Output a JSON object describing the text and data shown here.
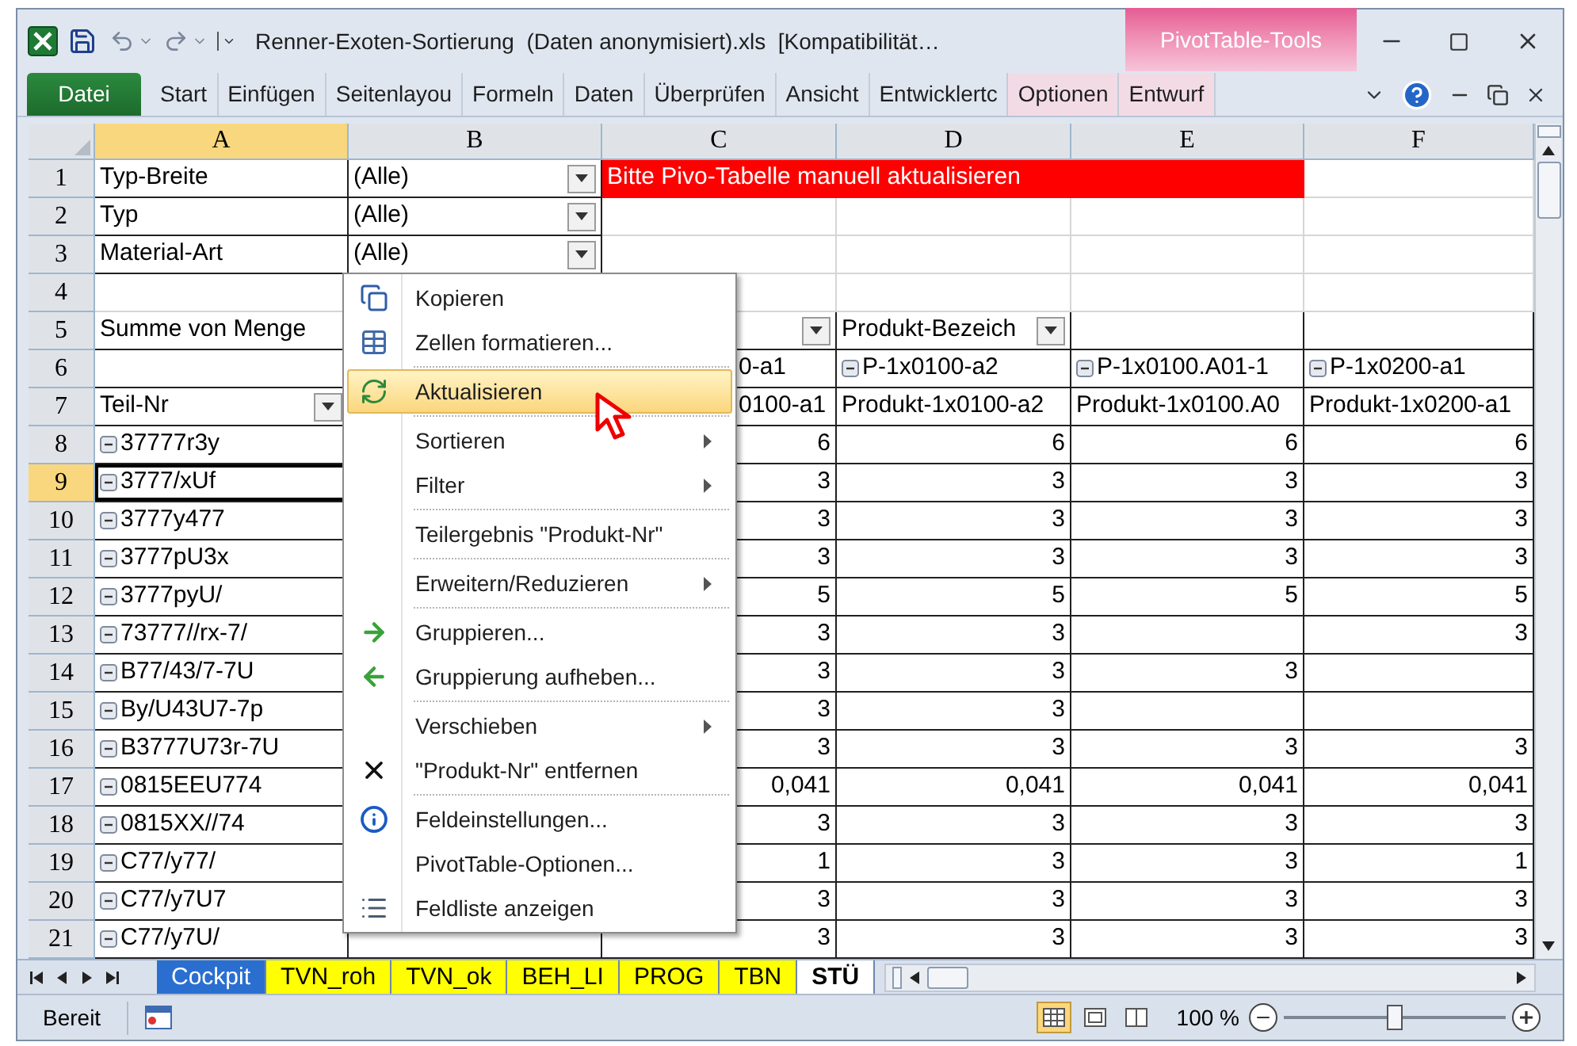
{
  "window": {
    "title": "Renner-Exoten-Sortierung  (Daten anonymisiert).xls  [Kompatibilität…",
    "context_group": "PivotTable-Tools"
  },
  "ribbon_tabs": [
    {
      "label": "Datei",
      "kind": "file"
    },
    {
      "label": "Start",
      "kind": "normal"
    },
    {
      "label": "Einfügen",
      "kind": "normal"
    },
    {
      "label": "Seitenlayou",
      "kind": "normal"
    },
    {
      "label": "Formeln",
      "kind": "normal"
    },
    {
      "label": "Daten",
      "kind": "normal"
    },
    {
      "label": "Überprüfen",
      "kind": "normal"
    },
    {
      "label": "Ansicht",
      "kind": "normal"
    },
    {
      "label": "Entwicklertc",
      "kind": "normal"
    },
    {
      "label": "Optionen",
      "kind": "context"
    },
    {
      "label": "Entwurf",
      "kind": "context"
    }
  ],
  "sheet": {
    "columns": [
      {
        "label": "A",
        "selected": true
      },
      {
        "label": "B",
        "selected": false
      },
      {
        "label": "C",
        "selected": false
      },
      {
        "label": "D",
        "selected": false
      },
      {
        "label": "E",
        "selected": false
      },
      {
        "label": "F",
        "selected": false
      }
    ],
    "rows": [
      {
        "number": "1",
        "selected": false,
        "cells": [
          {
            "kind": "text",
            "text": "Typ-Breite"
          },
          {
            "kind": "dropdown",
            "text": "(Alle)"
          },
          {
            "kind": "banner",
            "text": "Bitte Pivo-Tabelle manuell aktualisieren"
          },
          {
            "kind": "empty"
          }
        ]
      },
      {
        "number": "2",
        "selected": false,
        "cells": [
          {
            "kind": "text",
            "text": "Typ"
          },
          {
            "kind": "dropdown",
            "text": "(Alle)"
          },
          {
            "kind": "empty"
          },
          {
            "kind": "empty"
          },
          {
            "kind": "empty"
          },
          {
            "kind": "empty"
          }
        ]
      },
      {
        "number": "3",
        "selected": false,
        "cells": [
          {
            "kind": "text",
            "text": "Material-Art"
          },
          {
            "kind": "dropdown",
            "text": "(Alle)"
          },
          {
            "kind": "empty"
          },
          {
            "kind": "empty"
          },
          {
            "kind": "empty"
          },
          {
            "kind": "empty"
          }
        ]
      },
      {
        "number": "4",
        "selected": false,
        "cells": [
          {
            "kind": "empty"
          },
          {
            "kind": "hidden"
          },
          {
            "kind": "empty"
          },
          {
            "kind": "empty"
          },
          {
            "kind": "empty"
          },
          {
            "kind": "empty"
          }
        ]
      },
      {
        "number": "5",
        "selected": false,
        "cells": [
          {
            "kind": "text",
            "text": "Summe von  Menge"
          },
          {
            "kind": "hidden"
          },
          {
            "kind": "filter"
          },
          {
            "kind": "dropdown",
            "text": "Produkt-Bezeich"
          },
          {
            "kind": "blank"
          },
          {
            "kind": "blank"
          }
        ]
      },
      {
        "number": "6",
        "selected": false,
        "cells": [
          {
            "kind": "blank"
          },
          {
            "kind": "hidden"
          },
          {
            "kind": "clipped",
            "text": "0-a1"
          },
          {
            "kind": "item",
            "text": "P-1x0100-a2",
            "expanded": true
          },
          {
            "kind": "item",
            "text": "P-1x0100.A01-1",
            "expanded": true
          },
          {
            "kind": "item",
            "text": "P-1x0200-a1",
            "expanded": true
          }
        ]
      },
      {
        "number": "7",
        "selected": false,
        "cells": [
          {
            "kind": "dropdown",
            "text": "Teil-Nr"
          },
          {
            "kind": "hidden"
          },
          {
            "kind": "clipped",
            "text": "0100-a1"
          },
          {
            "kind": "text",
            "text": "Produkt-1x0100-a2"
          },
          {
            "kind": "text",
            "text": "Produkt-1x0100.A0"
          },
          {
            "kind": "text",
            "text": "Produkt-1x0200-a1"
          }
        ]
      },
      {
        "number": "8",
        "selected": false,
        "cells": [
          {
            "kind": "item",
            "text": "37777r3y",
            "expanded": true
          },
          {
            "kind": "blank"
          },
          {
            "kind": "number",
            "text": "6"
          },
          {
            "kind": "number",
            "text": "6"
          },
          {
            "kind": "number",
            "text": "6"
          },
          {
            "kind": "number",
            "text": "6"
          }
        ]
      },
      {
        "number": "9",
        "selected": true,
        "cells": [
          {
            "kind": "item",
            "text": "3777/xUf",
            "expanded": true
          },
          {
            "kind": "blank"
          },
          {
            "kind": "number",
            "text": "3"
          },
          {
            "kind": "number",
            "text": "3"
          },
          {
            "kind": "number",
            "text": "3"
          },
          {
            "kind": "number",
            "text": "3"
          }
        ]
      },
      {
        "number": "10",
        "selected": false,
        "cells": [
          {
            "kind": "item",
            "text": "3777y477",
            "expanded": true
          },
          {
            "kind": "blank"
          },
          {
            "kind": "number",
            "text": "3"
          },
          {
            "kind": "number",
            "text": "3"
          },
          {
            "kind": "number",
            "text": "3"
          },
          {
            "kind": "number",
            "text": "3"
          }
        ]
      },
      {
        "number": "11",
        "selected": false,
        "cells": [
          {
            "kind": "item",
            "text": "3777pU3x",
            "expanded": true
          },
          {
            "kind": "blank"
          },
          {
            "kind": "number",
            "text": "3"
          },
          {
            "kind": "number",
            "text": "3"
          },
          {
            "kind": "number",
            "text": "3"
          },
          {
            "kind": "number",
            "text": "3"
          }
        ]
      },
      {
        "number": "12",
        "selected": false,
        "cells": [
          {
            "kind": "item",
            "text": "3777pyU/",
            "expanded": true
          },
          {
            "kind": "blank"
          },
          {
            "kind": "number",
            "text": "5"
          },
          {
            "kind": "number",
            "text": "5"
          },
          {
            "kind": "number",
            "text": "5"
          },
          {
            "kind": "number",
            "text": "5"
          }
        ]
      },
      {
        "number": "13",
        "selected": false,
        "cells": [
          {
            "kind": "item",
            "text": "73777//rx-7/",
            "expanded": true
          },
          {
            "kind": "blank"
          },
          {
            "kind": "number",
            "text": "3"
          },
          {
            "kind": "number",
            "text": "3"
          },
          {
            "kind": "blank"
          },
          {
            "kind": "number",
            "text": "3"
          }
        ]
      },
      {
        "number": "14",
        "selected": false,
        "cells": [
          {
            "kind": "item",
            "text": "B77/43/7-7U",
            "expanded": true
          },
          {
            "kind": "blank"
          },
          {
            "kind": "number",
            "text": "3"
          },
          {
            "kind": "number",
            "text": "3"
          },
          {
            "kind": "number",
            "text": "3"
          },
          {
            "kind": "blank"
          }
        ]
      },
      {
        "number": "15",
        "selected": false,
        "cells": [
          {
            "kind": "item",
            "text": "By/U43U7-7p",
            "expanded": true
          },
          {
            "kind": "blank"
          },
          {
            "kind": "number",
            "text": "3"
          },
          {
            "kind": "number",
            "text": "3"
          },
          {
            "kind": "blank"
          },
          {
            "kind": "blank"
          }
        ]
      },
      {
        "number": "16",
        "selected": false,
        "cells": [
          {
            "kind": "item",
            "text": "B3777U73r-7U",
            "expanded": true
          },
          {
            "kind": "blank"
          },
          {
            "kind": "number",
            "text": "3"
          },
          {
            "kind": "number",
            "text": "3"
          },
          {
            "kind": "number",
            "text": "3"
          },
          {
            "kind": "number",
            "text": "3"
          }
        ]
      },
      {
        "number": "17",
        "selected": false,
        "cells": [
          {
            "kind": "item",
            "text": "0815EEU774",
            "expanded": true
          },
          {
            "kind": "blank"
          },
          {
            "kind": "number",
            "text": "0,041"
          },
          {
            "kind": "number",
            "text": "0,041"
          },
          {
            "kind": "number",
            "text": "0,041"
          },
          {
            "kind": "number",
            "text": "0,041"
          }
        ]
      },
      {
        "number": "18",
        "selected": false,
        "cells": [
          {
            "kind": "item",
            "text": "0815XX//74",
            "expanded": true
          },
          {
            "kind": "blank"
          },
          {
            "kind": "number",
            "text": "3"
          },
          {
            "kind": "number",
            "text": "3"
          },
          {
            "kind": "number",
            "text": "3"
          },
          {
            "kind": "number",
            "text": "3"
          }
        ]
      },
      {
        "number": "19",
        "selected": false,
        "cells": [
          {
            "kind": "item",
            "text": "C77/y77/",
            "expanded": true
          },
          {
            "kind": "blank"
          },
          {
            "kind": "number",
            "text": "1"
          },
          {
            "kind": "number",
            "text": "3"
          },
          {
            "kind": "number",
            "text": "3"
          },
          {
            "kind": "number",
            "text": "1"
          }
        ]
      },
      {
        "number": "20",
        "selected": false,
        "cells": [
          {
            "kind": "item",
            "text": "C77/y7U7",
            "expanded": true
          },
          {
            "kind": "blank"
          },
          {
            "kind": "number",
            "text": "3"
          },
          {
            "kind": "number",
            "text": "3"
          },
          {
            "kind": "number",
            "text": "3"
          },
          {
            "kind": "number",
            "text": "3"
          }
        ]
      },
      {
        "number": "21",
        "selected": false,
        "cells": [
          {
            "kind": "item",
            "text": "C77/y7U/",
            "expanded": true
          },
          {
            "kind": "blank"
          },
          {
            "kind": "number",
            "text": "3"
          },
          {
            "kind": "number",
            "text": "3"
          },
          {
            "kind": "number",
            "text": "3"
          },
          {
            "kind": "number",
            "text": "3"
          }
        ]
      }
    ]
  },
  "context_menu": [
    {
      "label": "Kopieren",
      "kind": "copy",
      "selected": false,
      "submenu": false,
      "separator_after": false
    },
    {
      "label": "Zellen formatieren...",
      "kind": "format",
      "selected": false,
      "submenu": false,
      "separator_after": true
    },
    {
      "label": "Aktualisieren",
      "kind": "refresh",
      "selected": true,
      "submenu": false,
      "separator_after": true
    },
    {
      "label": "Sortieren",
      "kind": "plain",
      "selected": false,
      "submenu": true,
      "separator_after": false
    },
    {
      "label": "Filter",
      "kind": "plain",
      "selected": false,
      "submenu": true,
      "separator_after": true
    },
    {
      "label": "Teilergebnis \"Produkt-Nr\"",
      "kind": "plain",
      "selected": false,
      "submenu": false,
      "separator_after": true
    },
    {
      "label": "Erweitern/Reduzieren",
      "kind": "plain",
      "selected": false,
      "submenu": true,
      "separator_after": true
    },
    {
      "label": "Gruppieren...",
      "kind": "group",
      "selected": false,
      "submenu": false,
      "separator_after": false
    },
    {
      "label": "Gruppierung aufheben...",
      "kind": "ungroup",
      "selected": false,
      "submenu": false,
      "separator_after": true
    },
    {
      "label": "Verschieben",
      "kind": "plain",
      "selected": false,
      "submenu": true,
      "separator_after": false
    },
    {
      "label": "\"Produkt-Nr\" entfernen",
      "kind": "remove",
      "selected": false,
      "submenu": false,
      "separator_after": true
    },
    {
      "label": "Feldeinstellungen...",
      "kind": "settings",
      "selected": false,
      "submenu": false,
      "separator_after": false
    },
    {
      "label": "PivotTable-Optionen...",
      "kind": "plain",
      "selected": false,
      "submenu": false,
      "separator_after": false
    },
    {
      "label": "Feldliste anzeigen",
      "kind": "list",
      "selected": false,
      "submenu": false,
      "separator_after": false
    }
  ],
  "sheet_tabs": [
    {
      "label": "Cockpit",
      "color": "#2a6fd0",
      "selected": false
    },
    {
      "label": "TVN_roh",
      "color": "#ffff00",
      "selected": false
    },
    {
      "label": "TVN_ok",
      "color": "#ffff00",
      "selected": false
    },
    {
      "label": "BEH_LI",
      "color": "#ffff00",
      "selected": false
    },
    {
      "label": "PROG",
      "color": "#ffff00",
      "selected": false
    },
    {
      "label": "TBN",
      "color": "#ffff00",
      "selected": false
    },
    {
      "label": "STÜ",
      "selected": true
    }
  ],
  "status_bar": {
    "status": "Bereit",
    "views": [
      {
        "kind": "normal",
        "selected": true
      },
      {
        "kind": "layout",
        "selected": false
      },
      {
        "kind": "pagebreak",
        "selected": false
      }
    ],
    "zoom": "100 %",
    "zoom_slider": {
      "level": 0.5
    }
  }
}
